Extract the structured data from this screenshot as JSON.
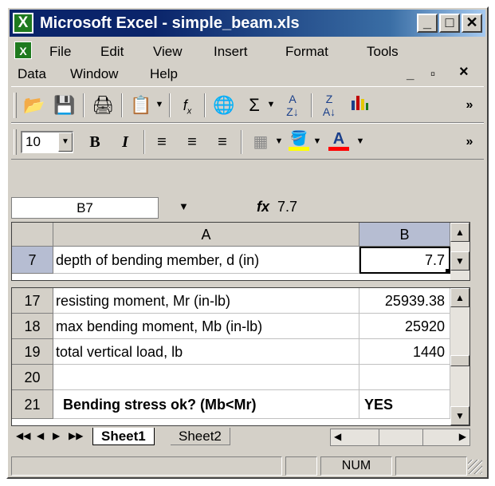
{
  "window": {
    "title": "Microsoft Excel - simple_beam.xls",
    "icon": "excel-icon",
    "controls": {
      "minimize": "_",
      "maximize": "□",
      "close": "✕"
    }
  },
  "menu": {
    "row1": [
      "File",
      "Edit",
      "View",
      "Insert",
      "Format",
      "Tools"
    ],
    "row2": [
      "Data",
      "Window",
      "Help"
    ],
    "doc_controls": {
      "minimize": "_",
      "restore": "▫",
      "close": "×"
    }
  },
  "toolbar_standard": {
    "icons": [
      "open-icon",
      "save-icon",
      "print-icon",
      "paste-icon",
      "function-icon",
      "web-icon",
      "autosum-icon",
      "sort-ascending-icon",
      "sort-descending-icon",
      "chart-wizard-icon",
      "more-icon"
    ]
  },
  "toolbar_formatting": {
    "font_size": "10",
    "icons": [
      "bold-icon",
      "italic-icon",
      "align-left-icon",
      "align-center-icon",
      "align-right-icon",
      "borders-icon",
      "fill-color-icon",
      "font-color-icon",
      "more-icon"
    ],
    "fill_color": "#ffff00",
    "font_color": "#ff0000"
  },
  "formula_bar": {
    "name_box": "B7",
    "fx_label": "fx",
    "formula": "7.7"
  },
  "columns": [
    "A",
    "B"
  ],
  "rows_frozen": [
    {
      "row": "7",
      "label": "depth of bending member, d (in)",
      "value": "7.7"
    }
  ],
  "rows": [
    {
      "row": "17",
      "label": "resisting moment, Mr (in-lb)",
      "value": "25939.38"
    },
    {
      "row": "18",
      "label": "max bending moment, Mb (in-lb)",
      "value": "25920"
    },
    {
      "row": "19",
      "label": "total vertical load, lb",
      "value": "1440"
    },
    {
      "row": "20",
      "label": "",
      "value": ""
    },
    {
      "row": "21",
      "label": "Bending stress ok? (Mb<Mr)",
      "value": "YES"
    }
  ],
  "sheets": {
    "active": "Sheet1",
    "other": "Sheet2"
  },
  "status": {
    "num": "NUM"
  }
}
